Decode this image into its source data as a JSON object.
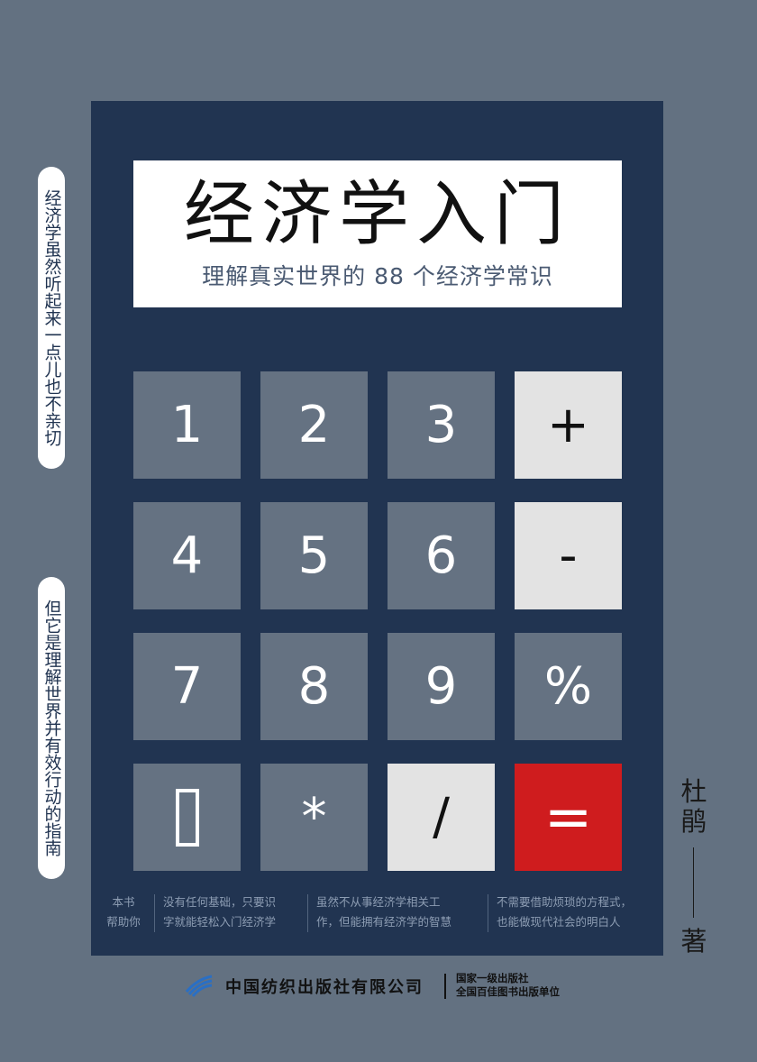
{
  "book": {
    "title": "经济学入门",
    "subtitle": "理解真实世界的 88 个经济学常识"
  },
  "keypad": {
    "row1": [
      "1",
      "2",
      "3",
      "+"
    ],
    "row2": [
      "4",
      "5",
      "6",
      "-"
    ],
    "row3": [
      "7",
      "8",
      "9",
      "%"
    ],
    "row4": [
      "",
      "*",
      "/",
      "="
    ]
  },
  "side_quotes": {
    "top": "经济学虽然听起来一点儿也不亲切",
    "bottom": "但它是理解世界并有效行动的指南"
  },
  "benefits": {
    "label_line1": "本书",
    "label_line2": "帮助你",
    "item1_line1": "没有任何基础，只要识",
    "item1_line2": "字就能轻松入门经济学",
    "item2_line1": "虽然不从事经济学相关工",
    "item2_line2": "作，但能拥有经济学的智慧",
    "item3_line1": "不需要借助烦琐的方程式，",
    "item3_line2": "也能做现代社会的明白人"
  },
  "author": {
    "name": "杜鹃",
    "role": "著"
  },
  "publisher": {
    "name": "中国纺织出版社有限公司",
    "note_line1": "国家一级出版社",
    "note_line2": "全国百佳图书出版单位"
  },
  "colors": {
    "background": "#637181",
    "calculator": "#213451",
    "key_dark": "#657282",
    "key_light": "#e3e3e3",
    "key_equals": "#cf1c1e",
    "logo_blue": "#2a6fc4"
  }
}
